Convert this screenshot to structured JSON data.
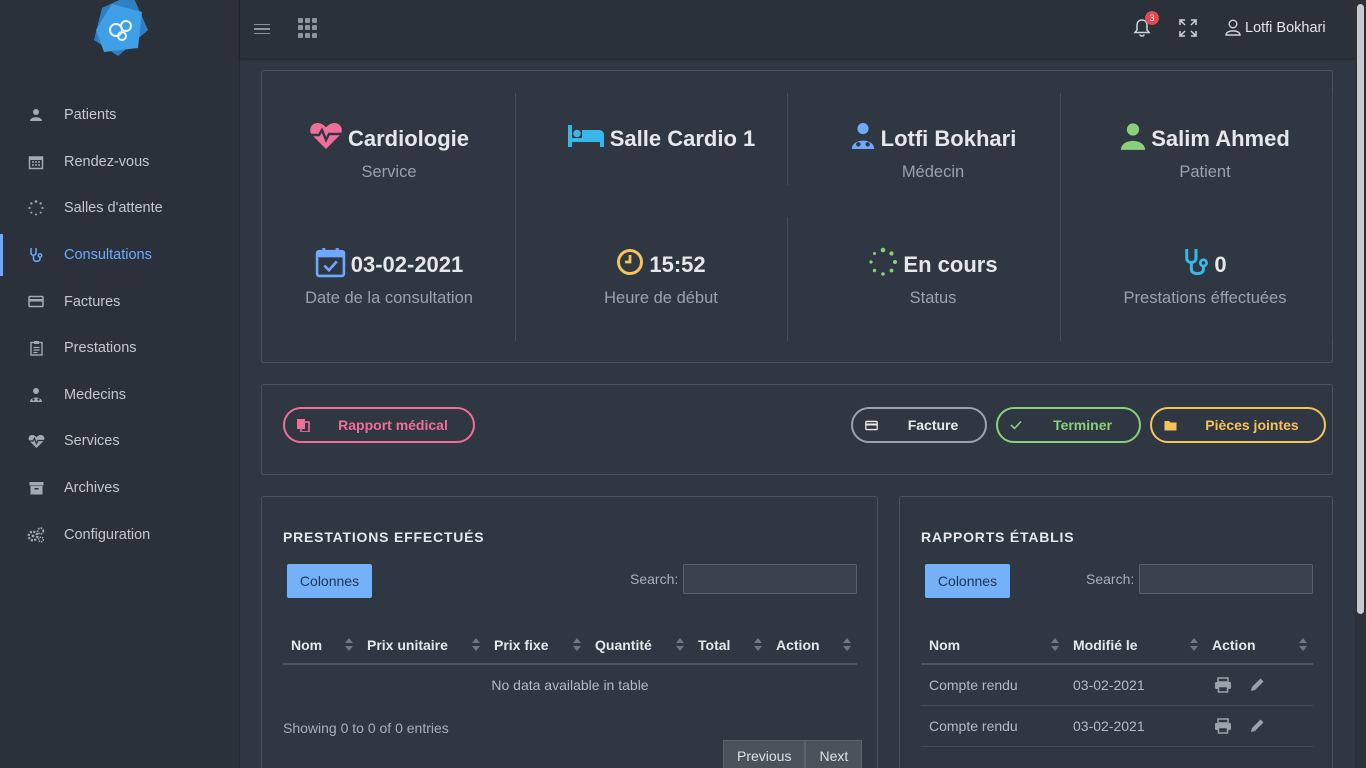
{
  "topbar": {
    "notifications_count": "3",
    "user_name": "Lotfi Bokhari"
  },
  "sidebar": {
    "items": [
      {
        "label": "Patients",
        "icon": "user-icon"
      },
      {
        "label": "Rendez-vous",
        "icon": "calendar-icon"
      },
      {
        "label": "Salles d'attente",
        "icon": "spinner-icon"
      },
      {
        "label": "Consultations",
        "icon": "stethoscope-icon",
        "active": true
      },
      {
        "label": "Factures",
        "icon": "credit-card-icon"
      },
      {
        "label": "Prestations",
        "icon": "clipboard-icon"
      },
      {
        "label": "Medecins",
        "icon": "doctor-icon"
      },
      {
        "label": "Services",
        "icon": "heartbeat-icon"
      },
      {
        "label": "Archives",
        "icon": "archive-icon"
      },
      {
        "label": "Configuration",
        "icon": "gears-icon"
      }
    ]
  },
  "info": {
    "service": {
      "value": "Cardiologie",
      "label": "Service"
    },
    "salle": {
      "value": "Salle Cardio 1"
    },
    "medecin": {
      "value": "Lotfi Bokhari",
      "label": "Médecin"
    },
    "patient": {
      "value": "Salim Ahmed",
      "label": "Patient"
    },
    "date": {
      "value": "03-02-2021",
      "label": "Date de la consultation"
    },
    "heure": {
      "value": "15:52",
      "label": "Heure de début"
    },
    "status": {
      "value": "En cours",
      "label": "Status"
    },
    "prestations": {
      "value": "0",
      "label": "Prestations éffectuées"
    }
  },
  "actions": {
    "rapport": "Rapport médical",
    "facture": "Facture",
    "terminer": "Terminer",
    "pieces": "Pièces jointes"
  },
  "colors": {
    "accent": "#6ea9ff",
    "pink": "#ef6f9a",
    "green": "#8bcf7b",
    "yellow": "#f6c25a",
    "cyan": "#37b8e8"
  },
  "prestations_panel": {
    "title": "PRESTATIONS EFFECTUÉS",
    "colonnes": "Colonnes",
    "search_label": "Search:",
    "search_value": "",
    "columns": [
      "Nom",
      "Prix unitaire",
      "Prix fixe",
      "Quantité",
      "Total",
      "Action"
    ],
    "empty": "No data available in table",
    "showing": "Showing 0 to 0 of 0 entries",
    "prev": "Previous",
    "next": "Next"
  },
  "rapports_panel": {
    "title": "RAPPORTS ÉTABLIS",
    "colonnes": "Colonnes",
    "search_label": "Search:",
    "search_value": "",
    "columns": [
      "Nom",
      "Modifié le",
      "Action"
    ],
    "rows": [
      {
        "nom": "Compte rendu",
        "date": "03-02-2021"
      },
      {
        "nom": "Compte rendu",
        "date": "03-02-2021"
      }
    ]
  }
}
